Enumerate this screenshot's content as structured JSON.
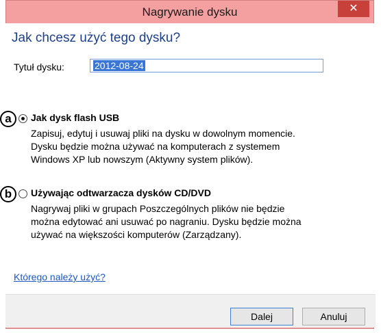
{
  "window": {
    "title": "Nagrywanie dysku",
    "close_glyph": "✕"
  },
  "heading": "Jak chcesz użyć tego dysku?",
  "disc_title": {
    "label": "Tytuł dysku:",
    "value": "2012-08-24"
  },
  "options": [
    {
      "badge": "a",
      "title": "Jak dysk flash USB",
      "selected": true,
      "description_lines": [
        "Zapisuj, edytuj i usuwaj pliki na dysku w dowolnym momencie.",
        "Dysku będzie można używać na komputerach z systemem",
        "Windows XP lub nowszym (Aktywny system plików)."
      ]
    },
    {
      "badge": "b",
      "title": "Używając odtwarzacza dysków CD/DVD",
      "selected": false,
      "description_lines": [
        "Nagrywaj pliki w grupach Poszczególnych plików nie będzie",
        "można edytować ani usuwać po nagraniu. Dysku będzie można",
        "używać na większości komputerów (Zarządzany)."
      ]
    }
  ],
  "help_link": "Którego należy użyć?",
  "buttons": {
    "next": "Dalej",
    "cancel": "Anuluj"
  },
  "colors": {
    "frame": "#f5a0a0",
    "close": "#c7403a",
    "heading": "#1b3f8a",
    "link": "#1b56c4",
    "selection": "#3a76d6"
  }
}
